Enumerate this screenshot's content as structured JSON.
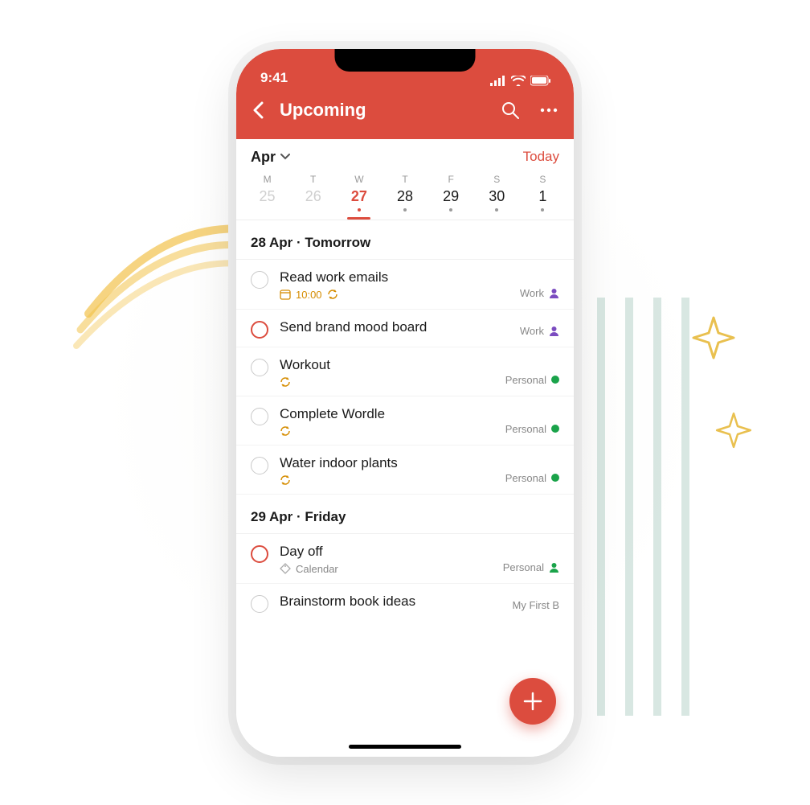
{
  "statusbar": {
    "time": "9:41"
  },
  "nav": {
    "title": "Upcoming"
  },
  "calendar": {
    "month_label": "Apr",
    "today_label": "Today",
    "days": [
      {
        "letter": "M",
        "num": "25",
        "faded": true
      },
      {
        "letter": "T",
        "num": "26",
        "faded": true
      },
      {
        "letter": "W",
        "num": "27",
        "selected": true,
        "dot": true
      },
      {
        "letter": "T",
        "num": "28",
        "dot": true
      },
      {
        "letter": "F",
        "num": "29",
        "dot": true
      },
      {
        "letter": "S",
        "num": "30",
        "dot": true
      },
      {
        "letter": "S",
        "num": "1",
        "dot": true
      }
    ]
  },
  "sections": [
    {
      "header": "28 Apr · Tomorrow",
      "tasks": [
        {
          "title": "Read work emails",
          "time": "10:00",
          "calendar_icon": true,
          "recurring": true,
          "project": "Work",
          "project_style": "person-purple"
        },
        {
          "title": "Send brand mood board",
          "priority": true,
          "project": "Work",
          "project_style": "person-purple"
        },
        {
          "title": "Workout",
          "recurring": true,
          "project": "Personal",
          "project_style": "dot-green"
        },
        {
          "title": "Complete Wordle",
          "recurring": true,
          "project": "Personal",
          "project_style": "dot-green"
        },
        {
          "title": "Water indoor plants",
          "recurring": true,
          "project": "Personal",
          "project_style": "dot-green"
        }
      ]
    },
    {
      "header": "29 Apr · Friday",
      "tasks": [
        {
          "title": "Day off",
          "priority": true,
          "label": "Calendar",
          "project": "Personal",
          "project_style": "person-green"
        },
        {
          "title": "Brainstorm book ideas",
          "project": "My First B",
          "project_style": "none"
        }
      ]
    }
  ],
  "colors": {
    "accent": "#dc4c3e"
  }
}
